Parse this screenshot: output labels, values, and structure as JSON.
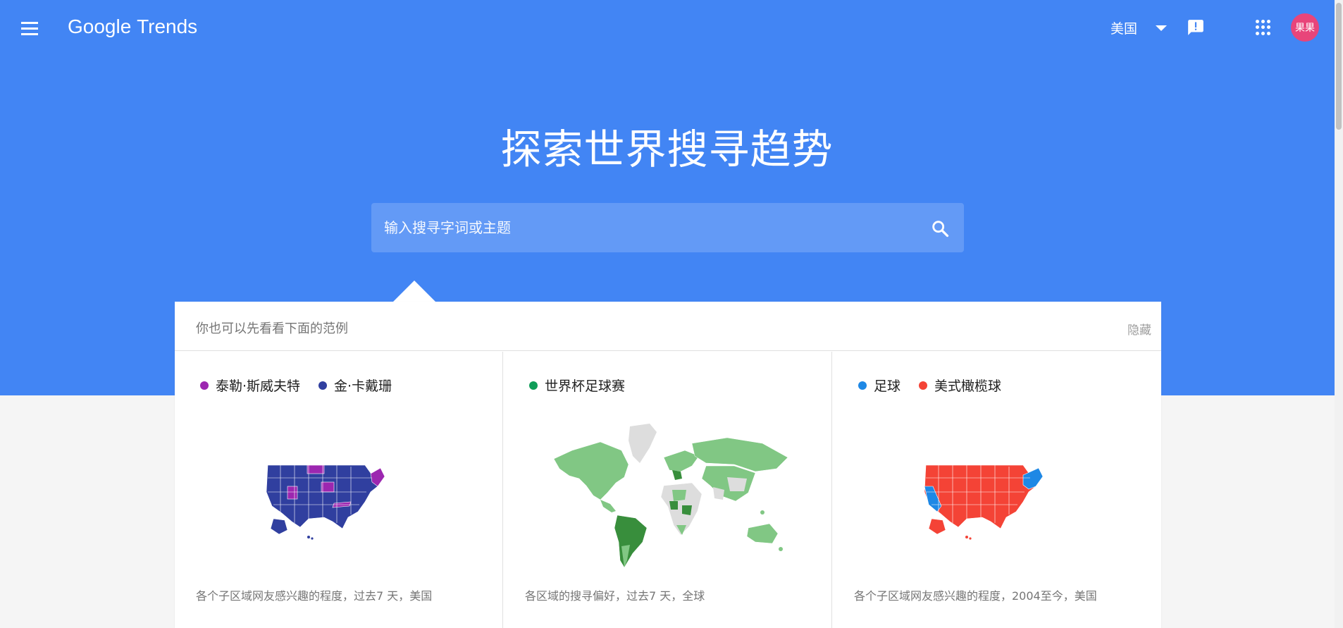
{
  "header": {
    "logo_google": "Google",
    "logo_trends": "Trends",
    "country": "美国",
    "avatar_text": "果果"
  },
  "hero": {
    "headline": "探索世界搜寻趋势",
    "search_placeholder": "输入搜寻字词或主题"
  },
  "examples": {
    "title": "你也可以先看看下面的范例",
    "hide_label": "隐藏",
    "cards": [
      {
        "legend": [
          {
            "label": "泰勒·斯威夫特",
            "color": "#9c27b0"
          },
          {
            "label": "金·卡戴珊",
            "color": "#303f9f"
          }
        ],
        "caption": "各个子区域网友感兴趣的程度，过去7 天，美国"
      },
      {
        "legend": [
          {
            "label": "世界杯足球赛",
            "color": "#0f9d58"
          }
        ],
        "caption": "各区域的搜寻偏好，过去7 天，全球"
      },
      {
        "legend": [
          {
            "label": "足球",
            "color": "#1e88e5"
          },
          {
            "label": "美式橄榄球",
            "color": "#f44336"
          }
        ],
        "caption": "各个子区域网友感兴趣的程度，2004至今，美国"
      }
    ]
  },
  "colors": {
    "hero_bg": "#4285f4",
    "search_bg": "#639af6",
    "avatar_bg": "#e8457a",
    "world_map_green": "#81c784",
    "world_map_dark_green": "#388e3c",
    "world_map_gray": "#dddddd"
  },
  "icons": [
    "menu-icon",
    "feedback-icon",
    "apps-icon",
    "search-icon",
    "caret-down-icon"
  ]
}
